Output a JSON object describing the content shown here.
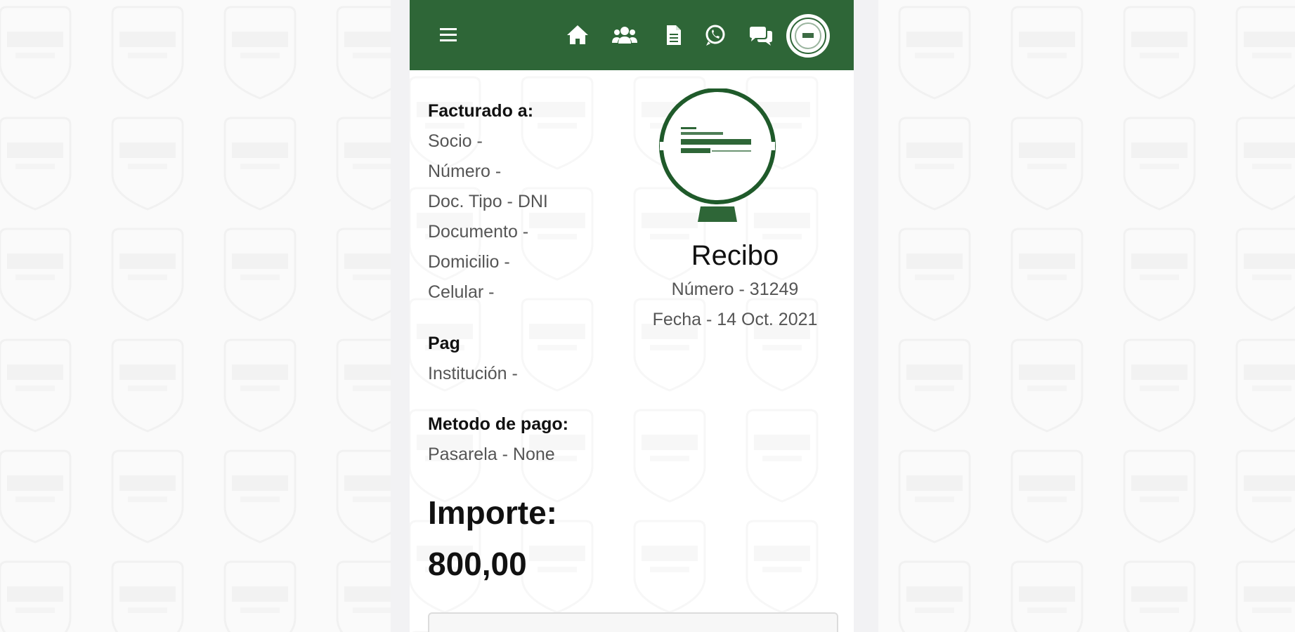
{
  "nav": {
    "menu_icon": "hamburger-icon",
    "icons": [
      "home-icon",
      "users-icon",
      "document-icon",
      "whatsapp-icon",
      "chat-icon"
    ],
    "avatar_icon": "profile-avatar"
  },
  "billing": {
    "heading": "Facturado a:",
    "lines": [
      "Socio -",
      "Número -",
      "Doc. Tipo - DNI",
      "Documento -",
      "Domicilio -",
      "Celular -"
    ]
  },
  "payment": {
    "heading": "Pag",
    "institution": "Institución -"
  },
  "method": {
    "heading": "Metodo de pago:",
    "value": "Pasarela - None"
  },
  "receipt": {
    "title": "Recibo",
    "number": "Número - 31249",
    "date": "Fecha - 14 Oct. 2021"
  },
  "amount": {
    "label": "Importe:",
    "value": "800,00"
  },
  "colors": {
    "primary_green": "#2e6637",
    "background": "#fafafa"
  }
}
